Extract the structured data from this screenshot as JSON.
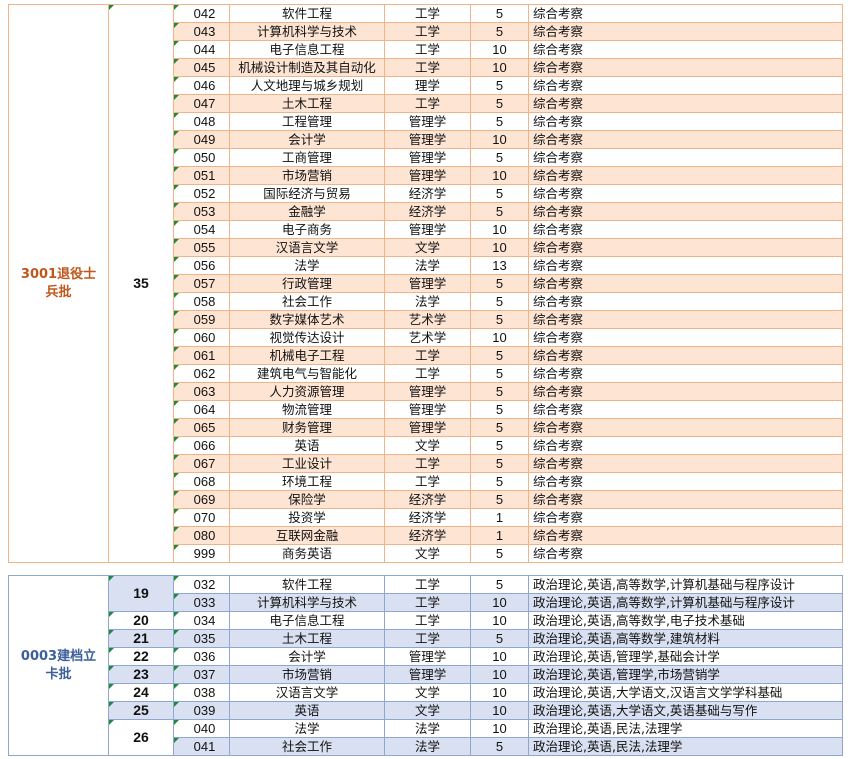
{
  "group1": {
    "batch": "3001退役士兵批",
    "quota": "35",
    "rows": [
      {
        "code": "042",
        "name": "软件工程",
        "cat": "工学",
        "num": "5",
        "req": "综合考察"
      },
      {
        "code": "043",
        "name": "计算机科学与技术",
        "cat": "工学",
        "num": "5",
        "req": "综合考察"
      },
      {
        "code": "044",
        "name": "电子信息工程",
        "cat": "工学",
        "num": "10",
        "req": "综合考察"
      },
      {
        "code": "045",
        "name": "机械设计制造及其自动化",
        "cat": "工学",
        "num": "10",
        "req": "综合考察"
      },
      {
        "code": "046",
        "name": "人文地理与城乡规划",
        "cat": "理学",
        "num": "5",
        "req": "综合考察"
      },
      {
        "code": "047",
        "name": "土木工程",
        "cat": "工学",
        "num": "5",
        "req": "综合考察"
      },
      {
        "code": "048",
        "name": "工程管理",
        "cat": "管理学",
        "num": "5",
        "req": "综合考察"
      },
      {
        "code": "049",
        "name": "会计学",
        "cat": "管理学",
        "num": "10",
        "req": "综合考察"
      },
      {
        "code": "050",
        "name": "工商管理",
        "cat": "管理学",
        "num": "5",
        "req": "综合考察"
      },
      {
        "code": "051",
        "name": "市场营销",
        "cat": "管理学",
        "num": "10",
        "req": "综合考察"
      },
      {
        "code": "052",
        "name": "国际经济与贸易",
        "cat": "经济学",
        "num": "5",
        "req": "综合考察"
      },
      {
        "code": "053",
        "name": "金融学",
        "cat": "经济学",
        "num": "5",
        "req": "综合考察"
      },
      {
        "code": "054",
        "name": "电子商务",
        "cat": "管理学",
        "num": "10",
        "req": "综合考察"
      },
      {
        "code": "055",
        "name": "汉语言文学",
        "cat": "文学",
        "num": "10",
        "req": "综合考察"
      },
      {
        "code": "056",
        "name": "法学",
        "cat": "法学",
        "num": "13",
        "req": "综合考察"
      },
      {
        "code": "057",
        "name": "行政管理",
        "cat": "管理学",
        "num": "5",
        "req": "综合考察"
      },
      {
        "code": "058",
        "name": "社会工作",
        "cat": "法学",
        "num": "5",
        "req": "综合考察"
      },
      {
        "code": "059",
        "name": "数字媒体艺术",
        "cat": "艺术学",
        "num": "5",
        "req": "综合考察"
      },
      {
        "code": "060",
        "name": "视觉传达设计",
        "cat": "艺术学",
        "num": "10",
        "req": "综合考察"
      },
      {
        "code": "061",
        "name": "机械电子工程",
        "cat": "工学",
        "num": "5",
        "req": "综合考察"
      },
      {
        "code": "062",
        "name": "建筑电气与智能化",
        "cat": "工学",
        "num": "5",
        "req": "综合考察"
      },
      {
        "code": "063",
        "name": "人力资源管理",
        "cat": "管理学",
        "num": "5",
        "req": "综合考察"
      },
      {
        "code": "064",
        "name": "物流管理",
        "cat": "管理学",
        "num": "5",
        "req": "综合考察"
      },
      {
        "code": "065",
        "name": "财务管理",
        "cat": "管理学",
        "num": "5",
        "req": "综合考察"
      },
      {
        "code": "066",
        "name": "英语",
        "cat": "文学",
        "num": "5",
        "req": "综合考察"
      },
      {
        "code": "067",
        "name": "工业设计",
        "cat": "工学",
        "num": "5",
        "req": "综合考察"
      },
      {
        "code": "068",
        "name": "环境工程",
        "cat": "工学",
        "num": "5",
        "req": "综合考察"
      },
      {
        "code": "069",
        "name": "保险学",
        "cat": "经济学",
        "num": "5",
        "req": "综合考察"
      },
      {
        "code": "070",
        "name": "投资学",
        "cat": "经济学",
        "num": "1",
        "req": "综合考察"
      },
      {
        "code": "080",
        "name": "互联网金融",
        "cat": "经济学",
        "num": "1",
        "req": "综合考察"
      },
      {
        "code": "999",
        "name": "商务英语",
        "cat": "文学",
        "num": "5",
        "req": "综合考察"
      }
    ]
  },
  "group2": {
    "batch": "0003建档立卡批",
    "quotas": [
      {
        "value": "19",
        "span": 2
      },
      {
        "value": "20",
        "span": 1
      },
      {
        "value": "21",
        "span": 1
      },
      {
        "value": "22",
        "span": 1
      },
      {
        "value": "23",
        "span": 1
      },
      {
        "value": "24",
        "span": 1
      },
      {
        "value": "25",
        "span": 1
      },
      {
        "value": "26",
        "span": 2
      }
    ],
    "rows": [
      {
        "code": "032",
        "name": "软件工程",
        "cat": "工学",
        "num": "5",
        "req": "政治理论,英语,高等数学,计算机基础与程序设计"
      },
      {
        "code": "033",
        "name": "计算机科学与技术",
        "cat": "工学",
        "num": "10",
        "req": "政治理论,英语,高等数学,计算机基础与程序设计"
      },
      {
        "code": "034",
        "name": "电子信息工程",
        "cat": "工学",
        "num": "10",
        "req": "政治理论,英语,高等数学,电子技术基础"
      },
      {
        "code": "035",
        "name": "土木工程",
        "cat": "工学",
        "num": "5",
        "req": "政治理论,英语,高等数学,建筑材料"
      },
      {
        "code": "036",
        "name": "会计学",
        "cat": "管理学",
        "num": "10",
        "req": "政治理论,英语,管理学,基础会计学"
      },
      {
        "code": "037",
        "name": "市场营销",
        "cat": "管理学",
        "num": "10",
        "req": "政治理论,英语,管理学,市场营销学"
      },
      {
        "code": "038",
        "name": "汉语言文学",
        "cat": "文学",
        "num": "10",
        "req": "政治理论,英语,大学语文,汉语言文学学科基础"
      },
      {
        "code": "039",
        "name": "英语",
        "cat": "文学",
        "num": "10",
        "req": "政治理论,英语,大学语文,英语基础与写作"
      },
      {
        "code": "040",
        "name": "法学",
        "cat": "法学",
        "num": "10",
        "req": "政治理论,英语,民法,法理学"
      },
      {
        "code": "041",
        "name": "社会工作",
        "cat": "法学",
        "num": "5",
        "req": "政治理论,英语,民法,法理学"
      }
    ]
  }
}
